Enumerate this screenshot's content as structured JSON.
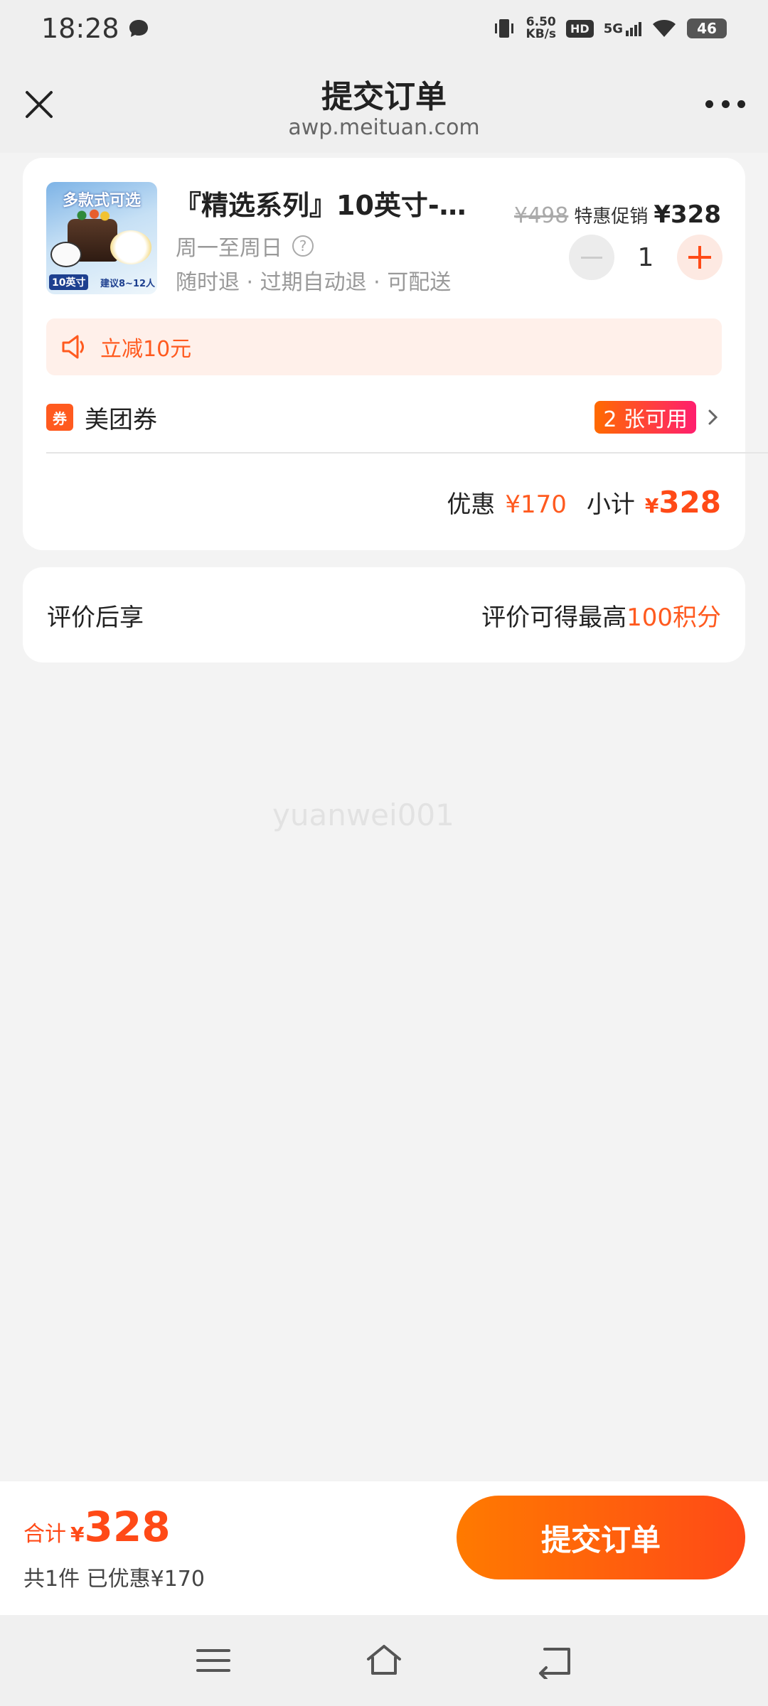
{
  "status_bar": {
    "time": "18:28",
    "speed_value": "6.50",
    "speed_unit": "KB/s",
    "hd": "HD",
    "network": "5G",
    "battery": "46"
  },
  "nav": {
    "title": "提交订单",
    "url": "awp.meituan.com"
  },
  "product": {
    "image_banner": "多款式可选",
    "image_size_tag": "10英寸",
    "image_note": "建议8~12人",
    "name": "『精选系列』10英寸-…",
    "days": "周一至周日",
    "tags": "随时退 · 过期自动退 · 可配送",
    "original_price": "¥498",
    "promo_label": "特惠促销",
    "price": "¥328",
    "quantity": "1"
  },
  "discount": {
    "text": "立减10元"
  },
  "coupon": {
    "icon_text": "券",
    "label": "美团券",
    "available": "2 张可用"
  },
  "subtotal": {
    "discount_label": "优惠",
    "discount_value": "¥170",
    "subtotal_label": "小计",
    "currency": "¥",
    "amount": "328"
  },
  "review": {
    "label": "评价后享",
    "desc_prefix": "评价可得最高",
    "desc_highlight": "100积分"
  },
  "watermark": "yuanwei001",
  "bottom": {
    "total_label": "合计",
    "currency": "¥",
    "total_amount": "328",
    "summary": "共1件  已优惠¥170",
    "submit_label": "提交订单"
  },
  "colors": {
    "accent": "#ff4a17",
    "accent_light": "#fff0ea",
    "background": "#f3f3f3"
  },
  "icons": [
    "chat-bubble-icon",
    "vibrate-icon",
    "signal-icon",
    "wifi-icon",
    "battery-icon",
    "close-icon",
    "more-icon",
    "help-icon",
    "minus-icon",
    "plus-icon",
    "speaker-icon",
    "coupon-icon",
    "chevron-right-icon",
    "menu-icon",
    "home-icon",
    "back-icon"
  ]
}
